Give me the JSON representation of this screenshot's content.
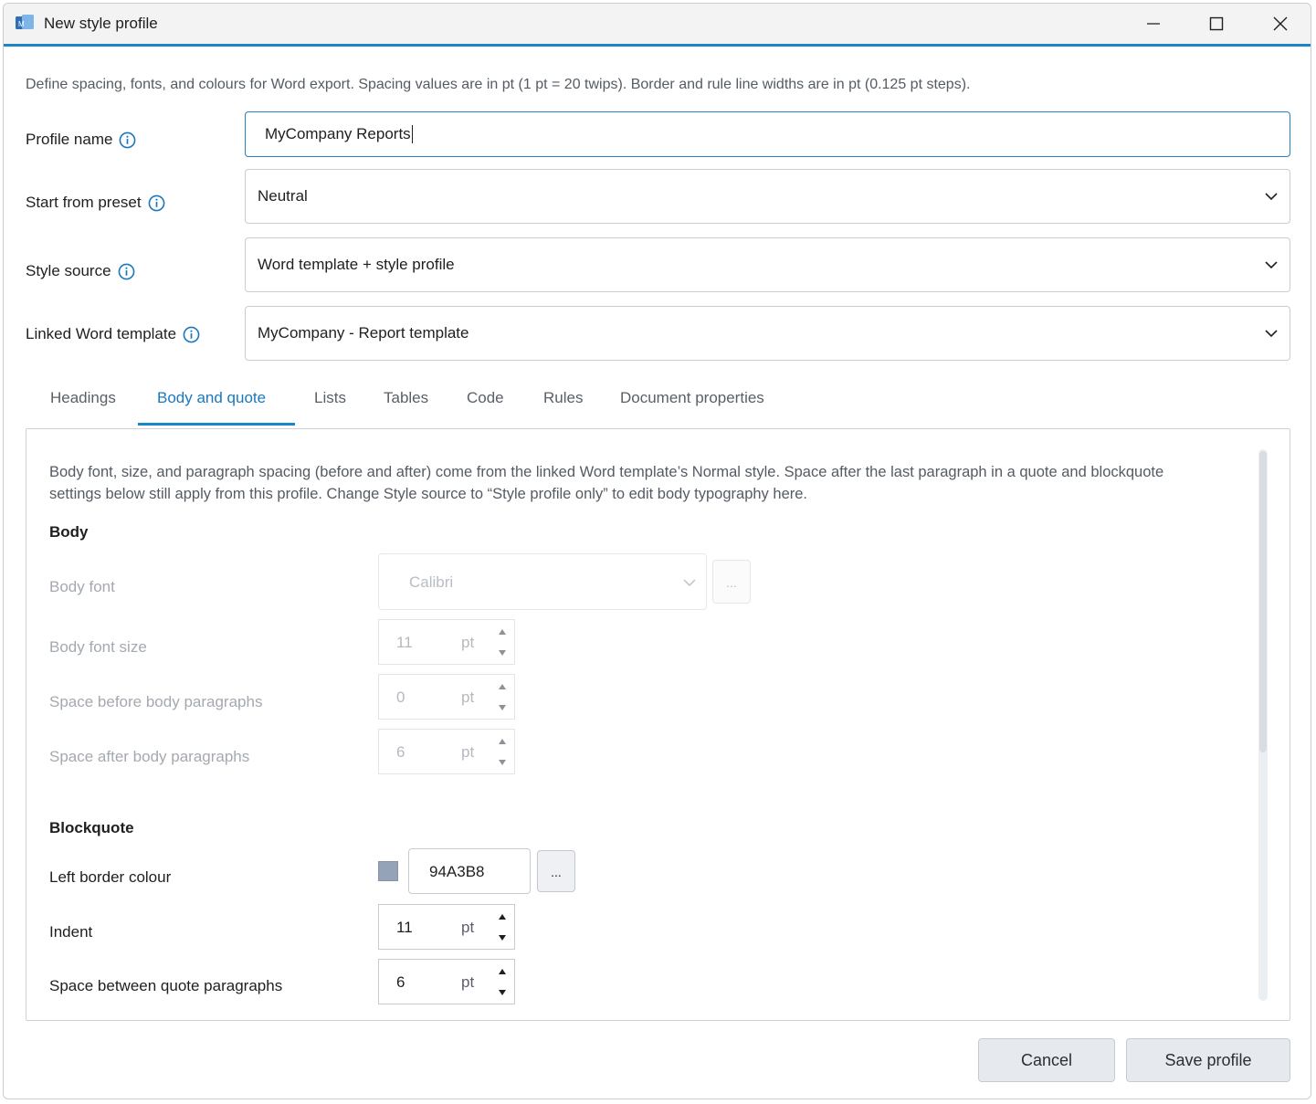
{
  "window": {
    "title": "New style profile"
  },
  "description": "Define spacing, fonts, and colours for Word export. Spacing values are in pt (1 pt = 20 twips). Border and rule line widths are in pt (0.125 pt steps).",
  "form": {
    "profile_name": {
      "label": "Profile name",
      "value": "MyCompany Reports"
    },
    "start_preset": {
      "label": "Start from preset",
      "value": "Neutral"
    },
    "style_source": {
      "label": "Style source",
      "value": "Word template + style profile"
    },
    "linked_template": {
      "label": "Linked Word template",
      "value": "MyCompany - Report template"
    }
  },
  "tabs": [
    {
      "label": "Headings",
      "active": false
    },
    {
      "label": "Body and quote",
      "active": true
    },
    {
      "label": "Lists",
      "active": false
    },
    {
      "label": "Tables",
      "active": false
    },
    {
      "label": "Code",
      "active": false
    },
    {
      "label": "Rules",
      "active": false
    },
    {
      "label": "Document properties",
      "active": false
    }
  ],
  "panel": {
    "note": "Body font, size, and paragraph spacing (before and after) come from the linked Word template’s Normal style. Space after the last paragraph in a quote and blockquote settings below still apply from this profile. Change Style source to “Style profile only” to edit body typography here.",
    "body": {
      "heading": "Body",
      "font": {
        "label": "Body font",
        "value": "Calibri",
        "browse": "..."
      },
      "font_size": {
        "label": "Body font size",
        "value": "11",
        "unit": "pt"
      },
      "space_before": {
        "label": "Space before body paragraphs",
        "value": "0",
        "unit": "pt"
      },
      "space_after": {
        "label": "Space after body paragraphs",
        "value": "6",
        "unit": "pt"
      }
    },
    "blockquote": {
      "heading": "Blockquote",
      "border_colour": {
        "label": "Left border colour",
        "value": "94A3B8",
        "swatch": "#94A3B8",
        "browse": "..."
      },
      "indent": {
        "label": "Indent",
        "value": "11",
        "unit": "pt"
      },
      "space_between": {
        "label": "Space between quote paragraphs",
        "value": "6",
        "unit": "pt"
      }
    }
  },
  "footer": {
    "cancel": "Cancel",
    "save": "Save profile"
  },
  "colors": {
    "accent": "#1A86C8",
    "active_tab": "#1A78BD"
  }
}
